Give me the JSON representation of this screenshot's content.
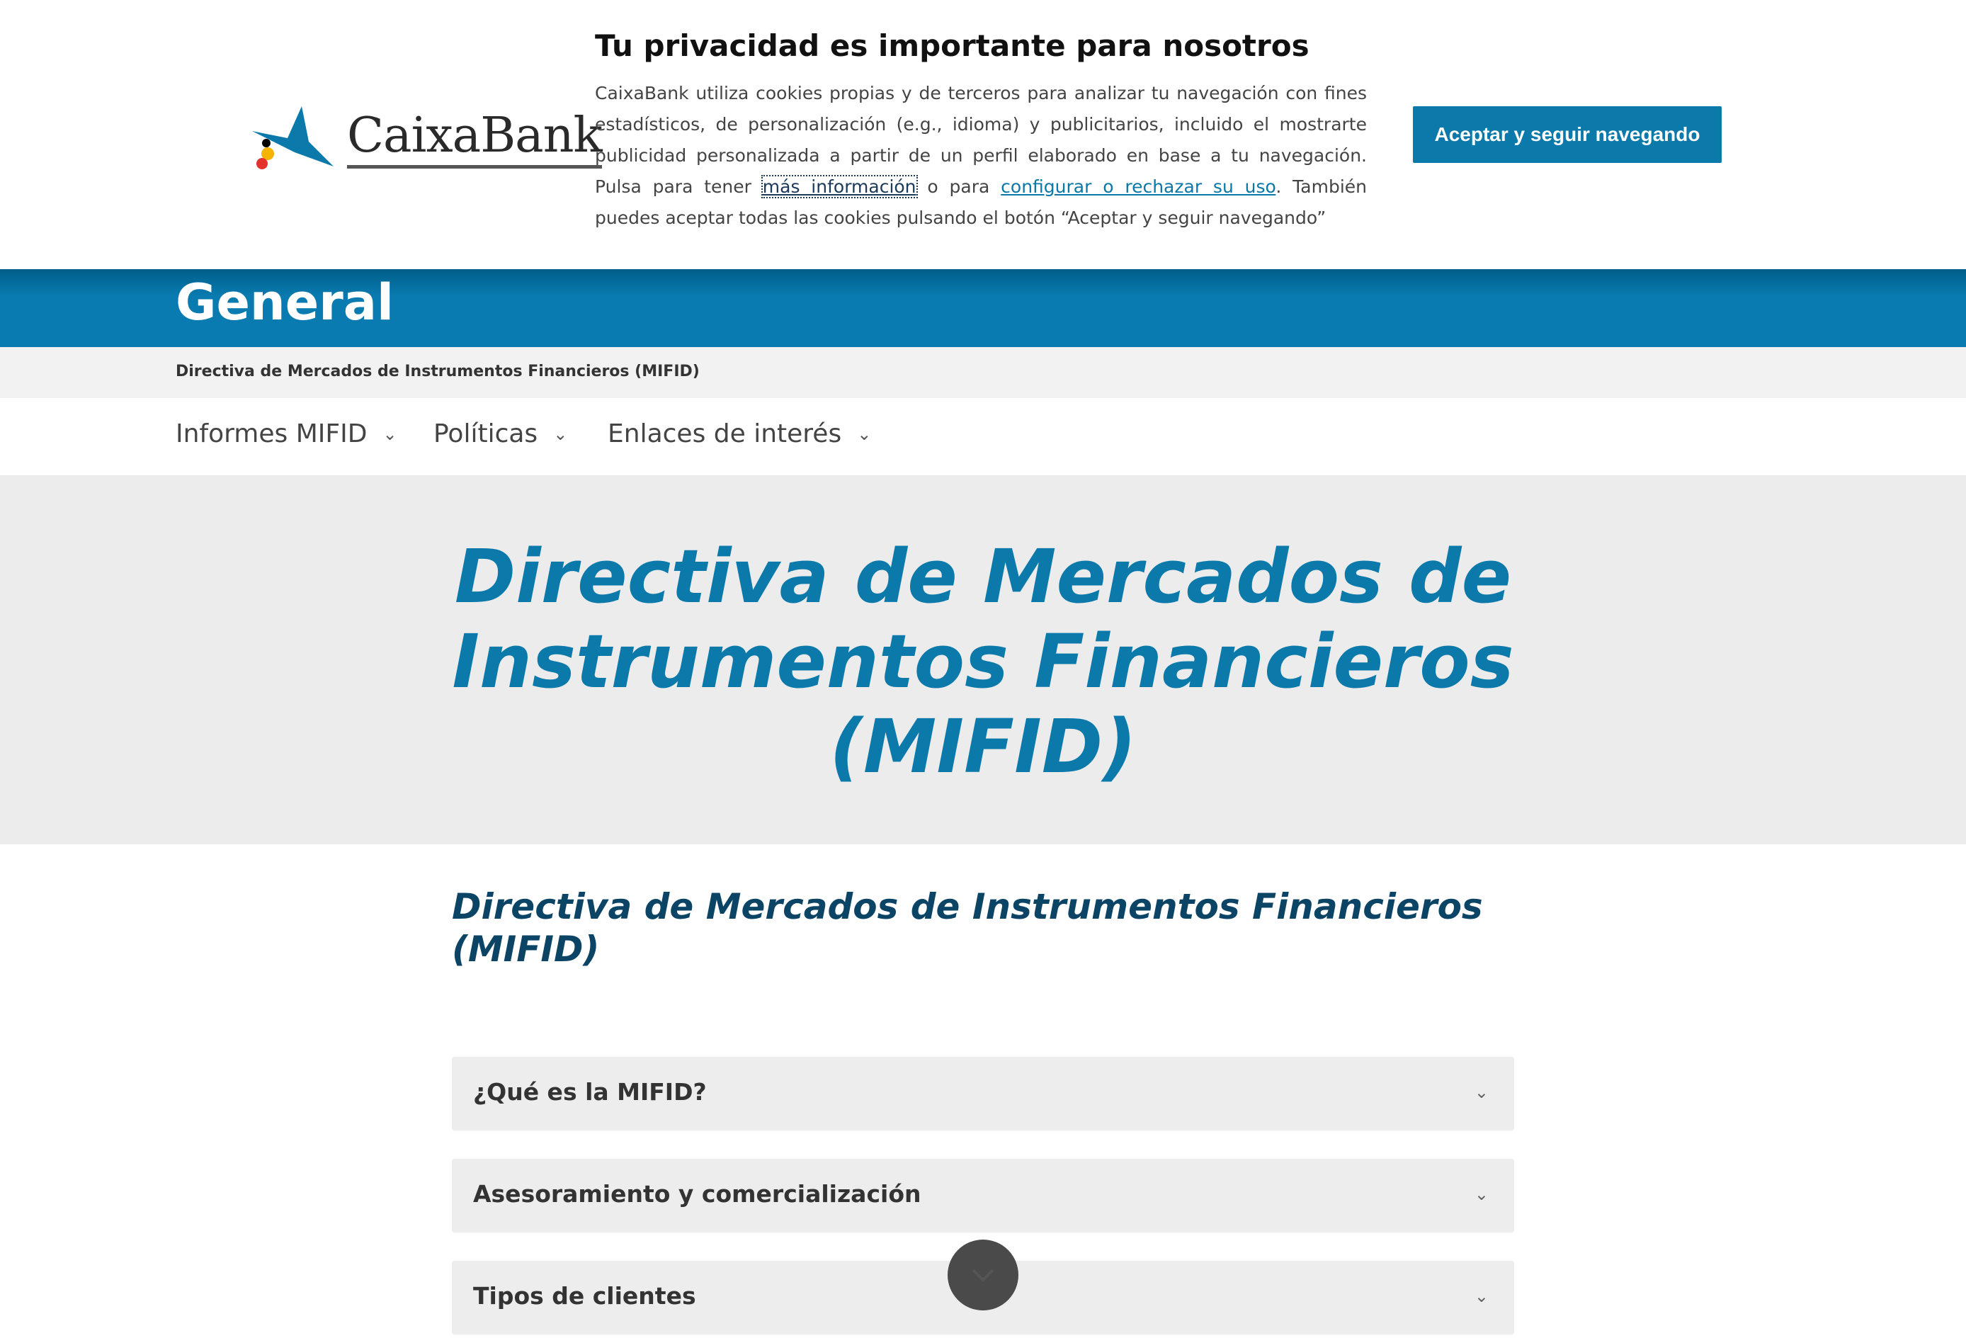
{
  "cookie": {
    "logo_text": "CaixaBank",
    "title": "Tu privacidad es importante para nosotros",
    "text_before": "CaixaBank utiliza cookies propias y de terceros para analizar tu navegación con fines estadísticos, de personalización (e.g., idioma) y publicitarios, incluido el mostrarte publicidad personalizada a partir de un perfil elaborado en base a tu navegación. Pulsa para tener ",
    "more_link": "más información",
    "text_middle": " o para ",
    "config_link": "configurar o rechazar su uso",
    "text_after": ". También puedes aceptar todas las cookies pulsando el botón “Aceptar y seguir navegando”",
    "accept_label": "Aceptar y seguir navegando"
  },
  "header": {
    "title": "General"
  },
  "breadcrumb": "Directiva de Mercados de Instrumentos Financieros (MIFID)",
  "nav": [
    {
      "label": "Informes MIFID"
    },
    {
      "label": "Políticas"
    },
    {
      "label": "Enlaces de interés"
    }
  ],
  "hero": {
    "title": "Directiva de Mercados de Instrumentos Financieros (MIFID)"
  },
  "section": {
    "title": "Directiva de Mercados de Instrumentos Financieros (MIFID)"
  },
  "accordion": [
    {
      "label": "¿Qué es la MIFID?"
    },
    {
      "label": "Asesoramiento y comercialización"
    },
    {
      "label": "Tipos de clientes"
    }
  ],
  "colors": {
    "brand": "#0b7aab",
    "dark_heading": "#0c4466"
  }
}
